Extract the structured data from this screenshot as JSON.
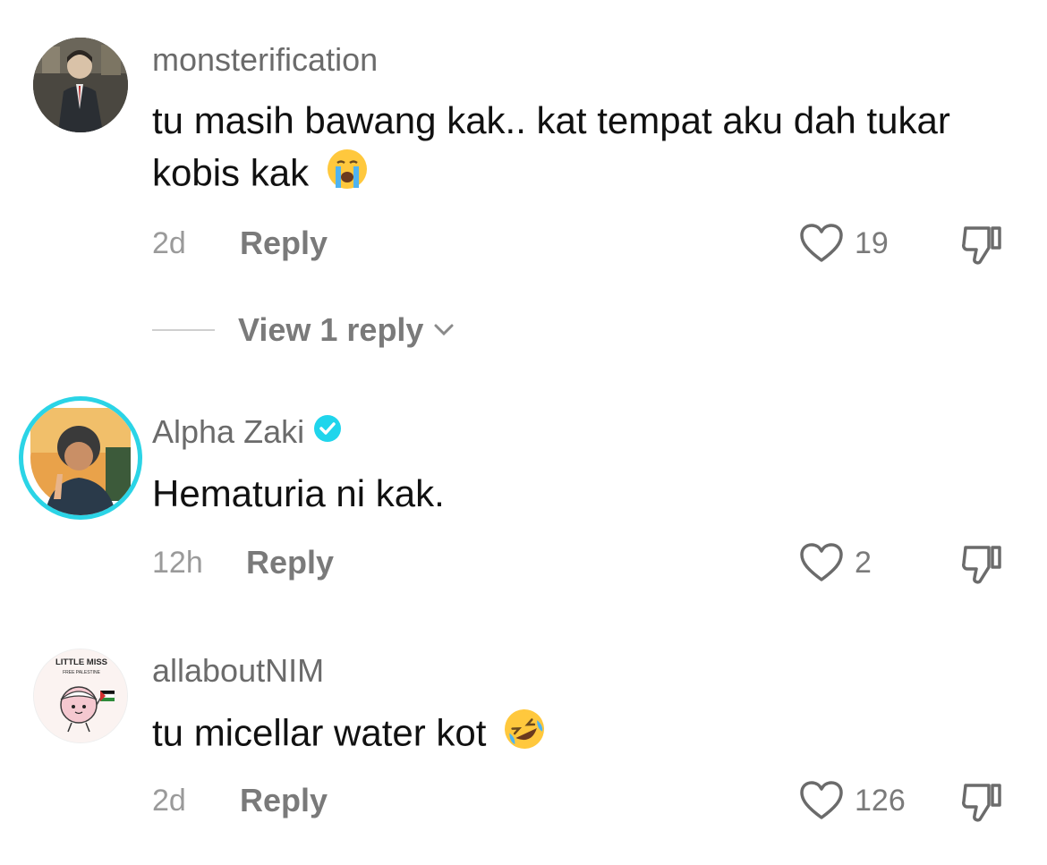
{
  "comments": [
    {
      "username": "monsterification",
      "text": "tu masih bawang kak.. kat tempat aku dah tukar kobis kak",
      "emoji": "crying-face",
      "time": "2d",
      "reply": "Reply",
      "likes": "19",
      "replies_label": "View 1 reply",
      "verified": false
    },
    {
      "username": "Alpha Zaki",
      "text": "Hematuria ni kak.",
      "time": "12h",
      "reply": "Reply",
      "likes": "2",
      "verified": true
    },
    {
      "username": "allaboutNIM",
      "text": "tu micellar water kot",
      "emoji": "rolling-laughing-face",
      "time": "2d",
      "reply": "Reply",
      "likes": "126",
      "verified": false,
      "avatar_text": {
        "line1": "LITTLE MISS",
        "line2": "FREE PALESTINE"
      }
    }
  ],
  "colors": {
    "username": "#6b6b6b",
    "text": "#111111",
    "meta": "#9a9a9a",
    "verified": "#20d5ec",
    "ring": "#2bd4e6"
  }
}
